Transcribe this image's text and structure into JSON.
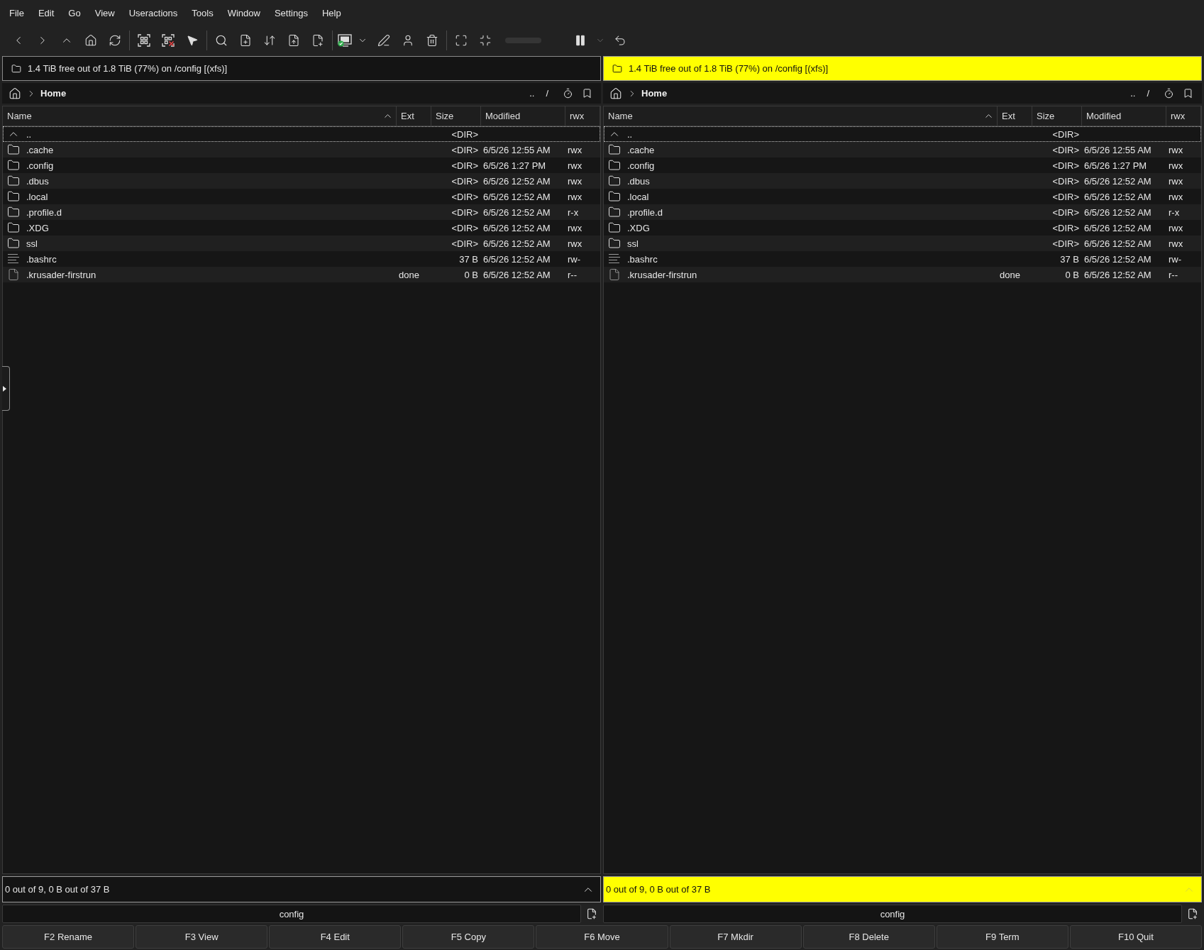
{
  "menu_bar": [
    "File",
    "Edit",
    "Go",
    "View",
    "Useractions",
    "Tools",
    "Window",
    "Settings",
    "Help"
  ],
  "panels": [
    {
      "active": false,
      "disk_info": "1.4 TiB free out of 1.8 TiB (77%) on /config [(xfs)]",
      "location": "Home",
      "nav_buttons": [
        "..",
        "/"
      ],
      "columns": [
        {
          "label": "Name",
          "sorted": true
        },
        {
          "label": "Ext",
          "sorted": false
        },
        {
          "label": "Size",
          "sorted": false
        },
        {
          "label": "Modified",
          "sorted": false
        },
        {
          "label": "rwx",
          "sorted": false
        }
      ],
      "rows": [
        {
          "kind": "parent",
          "name": "..",
          "size": "<DIR>",
          "current": true
        },
        {
          "kind": "folder",
          "name": ".cache",
          "size": "<DIR>",
          "modified": "6/5/26 12:55 AM",
          "permissions": "rwx",
          "current": false
        },
        {
          "kind": "folder",
          "name": ".config",
          "size": "<DIR>",
          "modified": "6/5/26 1:27 PM",
          "permissions": "rwx",
          "current": false
        },
        {
          "kind": "folder",
          "name": ".dbus",
          "size": "<DIR>",
          "modified": "6/5/26 12:52 AM",
          "permissions": "rwx",
          "current": false
        },
        {
          "kind": "folder",
          "name": ".local",
          "size": "<DIR>",
          "modified": "6/5/26 12:52 AM",
          "permissions": "rwx",
          "current": false
        },
        {
          "kind": "folder",
          "name": ".profile.d",
          "size": "<DIR>",
          "modified": "6/5/26 12:52 AM",
          "permissions": "r-x",
          "current": false
        },
        {
          "kind": "folder",
          "name": ".XDG",
          "size": "<DIR>",
          "modified": "6/5/26 12:52 AM",
          "permissions": "rwx",
          "current": false
        },
        {
          "kind": "folder",
          "name": "ssl",
          "size": "<DIR>",
          "modified": "6/5/26 12:52 AM",
          "permissions": "rwx",
          "current": false
        },
        {
          "kind": "text",
          "name": ".bashrc",
          "size": "37 B",
          "modified": "6/5/26 12:52 AM",
          "permissions": "rw-",
          "current": false
        },
        {
          "kind": "file",
          "name": ".krusader-firstrun",
          "ext": "done",
          "size": "0 B",
          "modified": "6/5/26 12:52 AM",
          "permissions": "r--",
          "current": false
        }
      ],
      "status": "0 out of 9, 0 B out of 37 B",
      "path": "config"
    },
    {
      "active": true,
      "disk_info": "1.4 TiB free out of 1.8 TiB (77%) on /config [(xfs)]",
      "location": "Home",
      "nav_buttons": [
        "..",
        "/"
      ],
      "columns": [
        {
          "label": "Name",
          "sorted": true
        },
        {
          "label": "Ext",
          "sorted": false
        },
        {
          "label": "Size",
          "sorted": false
        },
        {
          "label": "Modified",
          "sorted": false
        },
        {
          "label": "rwx",
          "sorted": false
        }
      ],
      "rows": [
        {
          "kind": "parent",
          "name": "..",
          "size": "<DIR>",
          "current": true
        },
        {
          "kind": "folder",
          "name": ".cache",
          "size": "<DIR>",
          "modified": "6/5/26 12:55 AM",
          "permissions": "rwx",
          "current": false
        },
        {
          "kind": "folder",
          "name": ".config",
          "size": "<DIR>",
          "modified": "6/5/26 1:27 PM",
          "permissions": "rwx",
          "current": false
        },
        {
          "kind": "folder",
          "name": ".dbus",
          "size": "<DIR>",
          "modified": "6/5/26 12:52 AM",
          "permissions": "rwx",
          "current": false
        },
        {
          "kind": "folder",
          "name": ".local",
          "size": "<DIR>",
          "modified": "6/5/26 12:52 AM",
          "permissions": "rwx",
          "current": false
        },
        {
          "kind": "folder",
          "name": ".profile.d",
          "size": "<DIR>",
          "modified": "6/5/26 12:52 AM",
          "permissions": "r-x",
          "current": false
        },
        {
          "kind": "folder",
          "name": ".XDG",
          "size": "<DIR>",
          "modified": "6/5/26 12:52 AM",
          "permissions": "rwx",
          "current": false
        },
        {
          "kind": "folder",
          "name": "ssl",
          "size": "<DIR>",
          "modified": "6/5/26 12:52 AM",
          "permissions": "rwx",
          "current": false
        },
        {
          "kind": "text",
          "name": ".bashrc",
          "size": "37 B",
          "modified": "6/5/26 12:52 AM",
          "permissions": "rw-",
          "current": false
        },
        {
          "kind": "file",
          "name": ".krusader-firstrun",
          "ext": "done",
          "size": "0 B",
          "modified": "6/5/26 12:52 AM",
          "permissions": "r--",
          "current": false
        }
      ],
      "status": "0 out of 9, 0 B out of 37 B",
      "path": "config"
    }
  ],
  "function_keys": [
    "F2 Rename",
    "F3 View",
    "F4 Edit",
    "F5 Copy",
    "F6 Move",
    "F7 Mkdir",
    "F8 Delete",
    "F9 Term",
    "F10 Quit"
  ]
}
